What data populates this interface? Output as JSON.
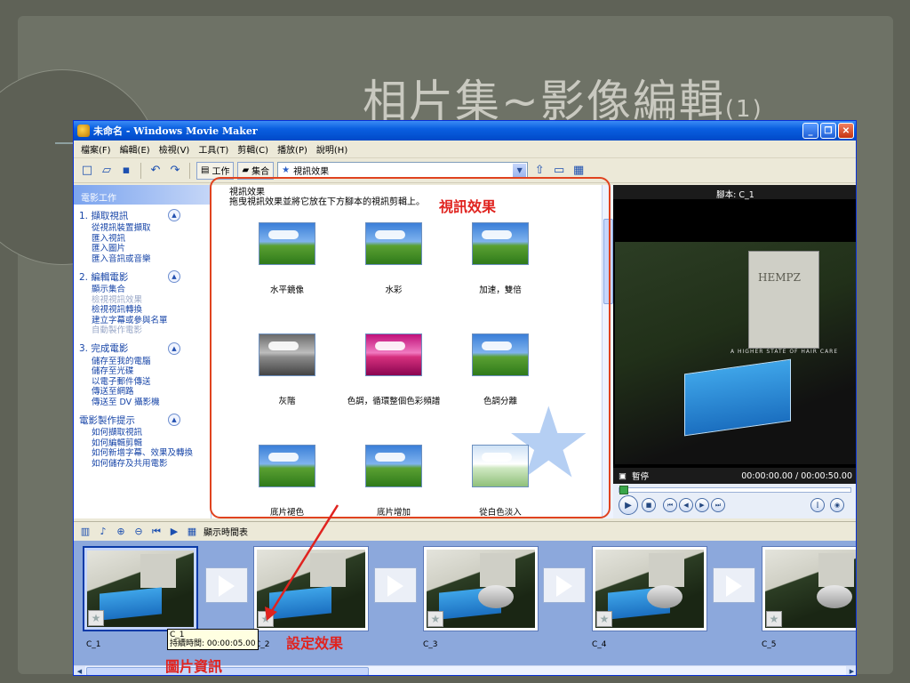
{
  "slide": {
    "title": "相片集~影像編輯",
    "title_sub": "(1)"
  },
  "window": {
    "title": "未命名 - Windows Movie Maker",
    "buttons": {
      "minimize": "_",
      "maximize": "❐",
      "close": "✕"
    }
  },
  "menu": [
    "檔案(F)",
    "編輯(E)",
    "檢視(V)",
    "工具(T)",
    "剪輯(C)",
    "播放(P)",
    "說明(H)"
  ],
  "toolbar": {
    "tasks_label": "工作",
    "collections_label": "集合",
    "combo_value": "視訊效果"
  },
  "tasks_pane": {
    "header": "電影工作",
    "sections": [
      {
        "title": "1. 擷取視訊",
        "items": [
          "從視訊裝置擷取",
          "匯入視訊",
          "匯入圖片",
          "匯入音訊或音樂"
        ]
      },
      {
        "title": "2. 編輯電影",
        "items": [
          "顯示集合",
          "檢視視訊效果",
          "檢視視訊轉換",
          "建立字幕或參與名單",
          "自動製作電影"
        ]
      },
      {
        "title": "3. 完成電影",
        "items": [
          "儲存至我的電腦",
          "儲存至光碟",
          "以電子郵件傳送",
          "傳送至網路",
          "傳送至 DV 攝影機"
        ]
      },
      {
        "title": "電影製作提示",
        "items": [
          "如何擷取視訊",
          "如何編輯剪輯",
          "如何新增字幕、效果及轉換",
          "如何儲存及共用電影"
        ]
      }
    ]
  },
  "effects_pane": {
    "title": "視訊效果",
    "hint": "拖曳視訊效果並將它放在下方腳本的視訊剪輯上。",
    "effects": [
      "水平鏡像",
      "水彩",
      "加速，雙倍",
      "灰階",
      "色調，循環整個色彩頻譜",
      "色調分離",
      "底片褪色",
      "底片增加",
      "從白色淡入"
    ]
  },
  "preview": {
    "title": "腳本: C_1",
    "poster_text": "HEMPZ",
    "slogan": "A HIGHER STATE OF HAIR CARE",
    "status": "暫停",
    "time": "00:00:00.00 / 00:00:50.00"
  },
  "storyboard": {
    "toolbar_label": "顯示時間表",
    "clips": [
      "C_1",
      "C_2",
      "C_3",
      "C_4",
      "C_5"
    ],
    "tooltip_name": "C_1",
    "tooltip_duration": "持續時間: 00:00:05.00"
  },
  "callouts": {
    "effects": "視訊效果",
    "set_effect": "設定效果",
    "image_info": "圖片資訊"
  },
  "colors": {
    "callout_red": "#e0231f",
    "xp_blue": "#0a5fe0",
    "storyboard_bg": "#8ca8dc"
  }
}
